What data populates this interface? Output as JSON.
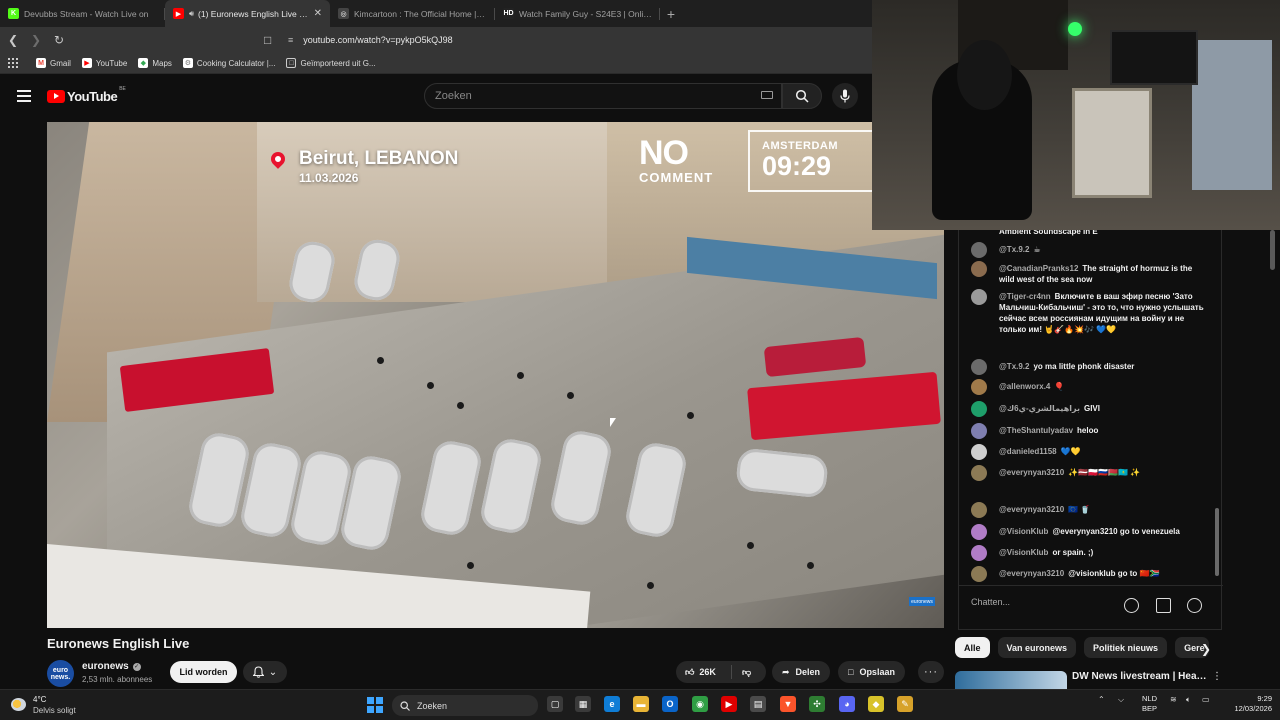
{
  "browser": {
    "tabs": [
      {
        "label": "Devubbs Stream - Watch Live on",
        "favicon_color": "#53fc18",
        "favicon_glyph": "K",
        "active": false,
        "audio": false
      },
      {
        "label": "(1) Euronews English Live - Yo",
        "favicon_color": "#ff0000",
        "favicon_glyph": "▶",
        "active": true,
        "audio": true
      },
      {
        "label": "Kimcartoon : The Official Home | kim",
        "favicon_color": "#444444",
        "favicon_glyph": "◎",
        "active": false,
        "audio": false
      },
      {
        "label": "Watch Family Guy - S24E3 | Online H",
        "favicon_color": "#222222",
        "favicon_glyph": "HD",
        "active": false,
        "audio": false
      }
    ],
    "url": "youtube.com/watch?v=pykpO5kQJ98",
    "bookmarks": [
      {
        "label": "Gmail",
        "icon": "gmail-icon",
        "color": "#ea4335",
        "glyph": "M"
      },
      {
        "label": "YouTube",
        "icon": "youtube-icon",
        "color": "#ff0000",
        "glyph": "▶"
      },
      {
        "label": "Maps",
        "icon": "maps-icon",
        "color": "#34a853",
        "glyph": "◆"
      },
      {
        "label": "Cooking Calculator |...",
        "icon": "calculator-icon",
        "color": "#777777",
        "glyph": "⚙"
      },
      {
        "label": "Geïmporteerd uit G...",
        "icon": "folder-icon",
        "color": "#353535",
        "glyph": "□"
      }
    ]
  },
  "youtube": {
    "logo_text": "YouTube",
    "logo_region": "BE",
    "search_placeholder": "Zoeken"
  },
  "video": {
    "location_city": "Beirut, LEBANON",
    "location_date": "11.03.2026",
    "brand_line1": "NO",
    "brand_line2": "COMMENT",
    "clock_city": "AMSTERDAM",
    "clock_time": "09:29",
    "watermark": "euronews"
  },
  "meta": {
    "title": "Euronews English Live",
    "channel_avatar_text": "euro news.",
    "channel_name": "euronews",
    "subscribers": "2,53 mln. abonnees",
    "join_label": "Lid worden",
    "likes": "26K",
    "share_label": "Delen",
    "save_label": "Opslaan"
  },
  "chat": {
    "messages": [
      {
        "author": "",
        "text": "Ambient Soundscape In E",
        "avatar_color": "#555555"
      },
      {
        "author": "@Tx.9.2",
        "text": "☕",
        "avatar_color": "#6b6b6b"
      },
      {
        "author": "@CanadianPranks12",
        "text": "The straight of hormuz is the wild west of the sea now",
        "avatar_color": "#8a6b4e"
      },
      {
        "author": "@Tiger-cr4nn",
        "text": "Включите в ваш эфир песню 'Зато Мальчиш-Кибальчиш' - это то, что нужно услышать сейчас всем россиянам идущим на войну и не только им! 🤘🎸🔥💥🎶 💙💛",
        "avatar_color": "#9a9a9a"
      },
      {
        "author": "@Tx.9.2",
        "text": "yo ma little phonk disaster",
        "avatar_color": "#6b6b6b"
      },
      {
        "author": "@allenworx.4",
        "text": "🎈",
        "avatar_color": "#a07a4a"
      },
      {
        "author": "@براهيمالشري-ي6ك",
        "text": "GIVI",
        "avatar_color": "#1e9e6a"
      },
      {
        "author": "@TheShantulyadav",
        "text": "heloo",
        "avatar_color": "#7f7fb0"
      },
      {
        "author": "@danieled1158",
        "text": "💙💛",
        "avatar_color": "#cfcfcf"
      },
      {
        "author": "@everynyan3210",
        "text": "✨🇱🇻🇵🇱🇷🇺🇧🇾🇰🇿 ✨",
        "avatar_color": "#8c7a55"
      },
      {
        "author": "@everynyan3210",
        "text": "🇪🇺 🥤",
        "avatar_color": "#8c7a55"
      },
      {
        "author": "@VisionKlub",
        "text": "@everynyan3210 go to venezuela",
        "avatar_color": "#b07cc6"
      },
      {
        "author": "@VisionKlub",
        "text": "or spain. ;)",
        "avatar_color": "#b07cc6"
      },
      {
        "author": "@everynyan3210",
        "text": "@visionklub go to 🇨🇳🇿🇦",
        "avatar_color": "#8c7a55"
      }
    ],
    "input_placeholder": "Chatten..."
  },
  "sidebar": {
    "chips": [
      {
        "label": "Alle",
        "active": true
      },
      {
        "label": "Van euronews",
        "active": false
      },
      {
        "label": "Politiek nieuws",
        "active": false
      },
      {
        "label": "Gere",
        "active": false
      }
    ],
    "recommendation_title": "DW News livestream | Headline"
  },
  "taskbar": {
    "weather_temp": "4°C",
    "weather_desc": "Delvis soligt",
    "search_label": "Zoeken",
    "lang_line1": "NLD",
    "lang_line2": "BEP",
    "time": "9:29",
    "date": "12/03/2026",
    "apps": [
      {
        "name": "task-view-icon",
        "color": "#3a3a3a",
        "glyph": "▢"
      },
      {
        "name": "widgets-icon",
        "color": "#3a3a3a",
        "glyph": "▦"
      },
      {
        "name": "edge-icon",
        "color": "#0f7dd6",
        "glyph": "e"
      },
      {
        "name": "file-explorer-icon",
        "color": "#e8b436",
        "glyph": "▬"
      },
      {
        "name": "outlook-icon",
        "color": "#0a64c8",
        "glyph": "O"
      },
      {
        "name": "chrome-icon",
        "color": "#2f9e44",
        "glyph": "◉"
      },
      {
        "name": "youtube-app-icon",
        "color": "#e00000",
        "glyph": "▶"
      },
      {
        "name": "calculator-app-icon",
        "color": "#4a4a4a",
        "glyph": "▤"
      },
      {
        "name": "brave-icon",
        "color": "#fb542b",
        "glyph": "▼"
      },
      {
        "name": "cura-icon",
        "color": "#2e7d32",
        "glyph": "✣"
      },
      {
        "name": "discord-icon",
        "color": "#5865f2",
        "glyph": "◕"
      },
      {
        "name": "game-icon",
        "color": "#d8c22a",
        "glyph": "◆"
      },
      {
        "name": "notes-icon",
        "color": "#d7a22a",
        "glyph": "✎"
      }
    ]
  }
}
